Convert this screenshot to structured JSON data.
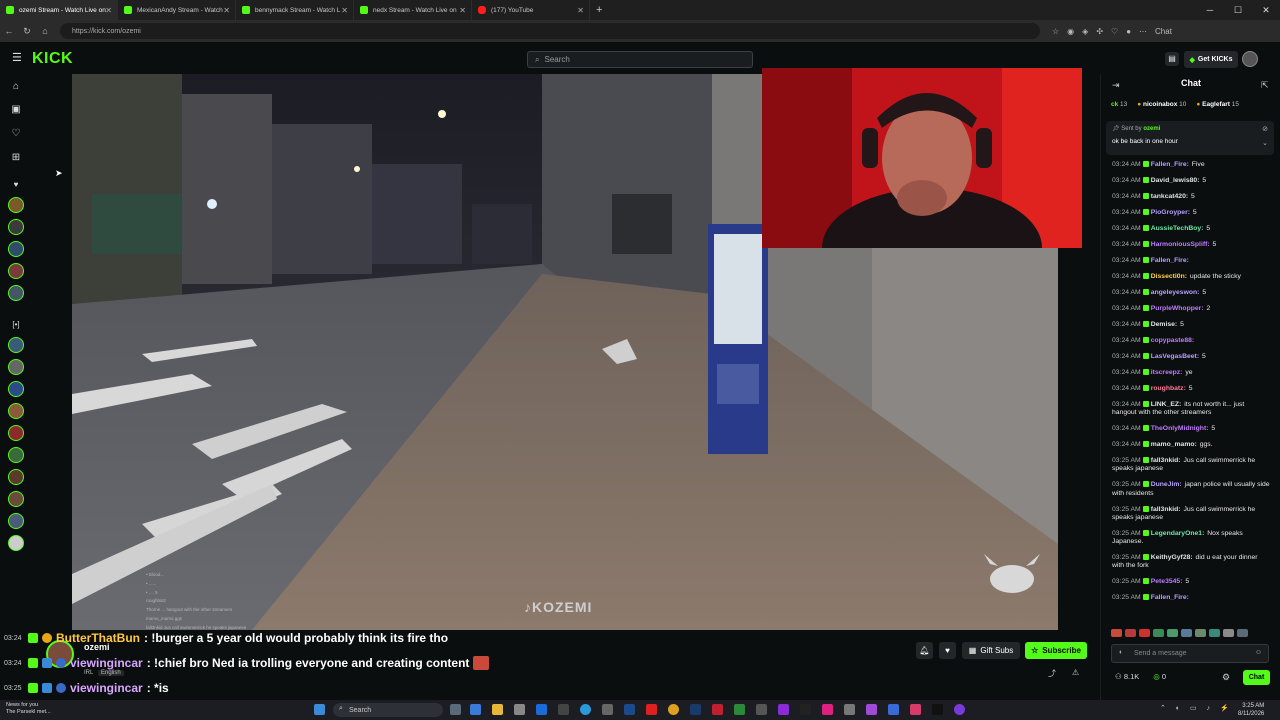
{
  "browser": {
    "tabs": [
      {
        "label": "ozemi Stream - Watch Live on",
        "icon": "kick-icon",
        "active": true
      },
      {
        "label": "MexicanAndy Stream - Watch",
        "icon": "kick-icon",
        "active": false
      },
      {
        "label": "bennymack Stream - Watch L",
        "icon": "kick-icon",
        "active": false
      },
      {
        "label": "nedx Stream - Watch Live on",
        "icon": "kick-icon",
        "active": false
      },
      {
        "label": "(177) YouTube",
        "icon": "youtube-icon",
        "active": false
      }
    ],
    "url": "https://kick.com/ozemi",
    "chat_ext_label": "Chat"
  },
  "kick": {
    "logo": "KICK",
    "search_placeholder": "Search",
    "get_kicks_label": "Get KICKs"
  },
  "stream": {
    "watermark": "KOZEMI"
  },
  "ticker": [
    {
      "time": "03:24",
      "user": "ButterThatBun",
      "text": ": !burger a 5 year old would probably think its fire tho",
      "user_color": "#ffc83d"
    },
    {
      "time": "03:24",
      "user": "viewingincar",
      "text": ": !chief bro Ned ia trolling everyone and creating content",
      "user_color": "#d8a6ff"
    },
    {
      "time": "03:25",
      "user": "viewingincar",
      "text": ": *is",
      "user_color": "#d8a6ff"
    }
  ],
  "streamer": {
    "name": "ozemi",
    "tag1": "IRL",
    "tag2": "English"
  },
  "controls": {
    "gift_label": "Gift Subs",
    "subscribe_label": "Subscribe"
  },
  "chat": {
    "title": "Chat",
    "leaderboard": [
      {
        "name": "ck",
        "count": "13"
      },
      {
        "name": "nicoinabox",
        "count": "10"
      },
      {
        "name": "Eaglefart",
        "count": "15"
      }
    ],
    "pinned": {
      "sent_by_label": "Sent by",
      "sender": "ozemi",
      "message": "ok be back in one hour"
    },
    "messages": [
      {
        "time": "03:24 AM",
        "user": "Fallen_Fire:",
        "text": "Five",
        "color": "#b8a0ff"
      },
      {
        "time": "03:24 AM",
        "user": "David_lewis80:",
        "text": "5",
        "color": "#dfe3e6"
      },
      {
        "time": "03:24 AM",
        "user": "tankcat420:",
        "text": "5",
        "color": "#dfe3e6"
      },
      {
        "time": "03:24 AM",
        "user": "PioGroyper:",
        "text": "5",
        "color": "#b8a0ff"
      },
      {
        "time": "03:24 AM",
        "user": "AussieTechBoy:",
        "text": "5",
        "color": "#6ee7a8"
      },
      {
        "time": "03:24 AM",
        "user": "HarmoniousSpliff:",
        "text": "5",
        "color": "#c07bff"
      },
      {
        "time": "03:24 AM",
        "user": "Fallen_Fire:",
        "text": "",
        "color": "#b8a0ff"
      },
      {
        "time": "03:24 AM",
        "user": "Dissecti0n:",
        "text": "update the sticky",
        "color": "#ffd24d"
      },
      {
        "time": "03:24 AM",
        "user": "angeleyeswon:",
        "text": "5",
        "color": "#b8a0ff"
      },
      {
        "time": "03:24 AM",
        "user": "PurpleWhopper:",
        "text": "2",
        "color": "#c07bff"
      },
      {
        "time": "03:24 AM",
        "user": "Demise:",
        "text": "5",
        "color": "#dfe3e6"
      },
      {
        "time": "03:24 AM",
        "user": "copypaste88:",
        "text": "",
        "color": "#c07bff"
      },
      {
        "time": "03:24 AM",
        "user": "LasVegasBeet:",
        "text": "5",
        "color": "#b8a0ff"
      },
      {
        "time": "03:24 AM",
        "user": "itscreepz:",
        "text": "ye",
        "color": "#c07bff"
      },
      {
        "time": "03:24 AM",
        "user": "roughbatz:",
        "text": "5",
        "color": "#ff7a9a"
      },
      {
        "time": "03:24 AM",
        "user": "LINK_EZ:",
        "text": "its not worth it... just hangout with the other streamers",
        "color": "#dfe3e6"
      },
      {
        "time": "03:24 AM",
        "user": "TheOnlyMidnight:",
        "text": "5",
        "color": "#c07bff"
      },
      {
        "time": "03:24 AM",
        "user": "mamo_mamo:",
        "text": "ggs.",
        "color": "#dfe3e6"
      },
      {
        "time": "03:25 AM",
        "user": "fall3nkid:",
        "text": "Jus call swimmerrick he speaks japanese",
        "color": "#dfe3e6"
      },
      {
        "time": "03:25 AM",
        "user": "DuneJim:",
        "text": "japan police will usually side with residents",
        "color": "#b8a0ff"
      },
      {
        "time": "03:25 AM",
        "user": "fall3nkid:",
        "text": "Jus call swimmerrick he speaks japanese",
        "color": "#dfe3e6"
      },
      {
        "time": "03:25 AM",
        "user": "LegendaryOne1:",
        "text": "Nox speaks Japanese.",
        "color": "#6ee7a8"
      },
      {
        "time": "03:25 AM",
        "user": "KeithyGyf28:",
        "text": "did u eat your dinner with the fork",
        "color": "#dfe3e6"
      },
      {
        "time": "03:25 AM",
        "user": "Pete3545:",
        "text": "5",
        "color": "#c07bff"
      },
      {
        "time": "03:25 AM",
        "user": "Fallen_Fire:",
        "text": "",
        "color": "#b8a0ff"
      }
    ],
    "input_placeholder": "Send a message",
    "viewers": "8.1K",
    "kicks": "0",
    "chat_button": "Chat"
  },
  "taskbar": {
    "weather_line1": "News for you",
    "weather_line2": "The Parsekl met...",
    "search_label": "Search",
    "time": "3:25 AM",
    "date": "8/11/2026"
  },
  "colors": {
    "kick_green": "#53fc18",
    "background": "#0b0e0f"
  }
}
